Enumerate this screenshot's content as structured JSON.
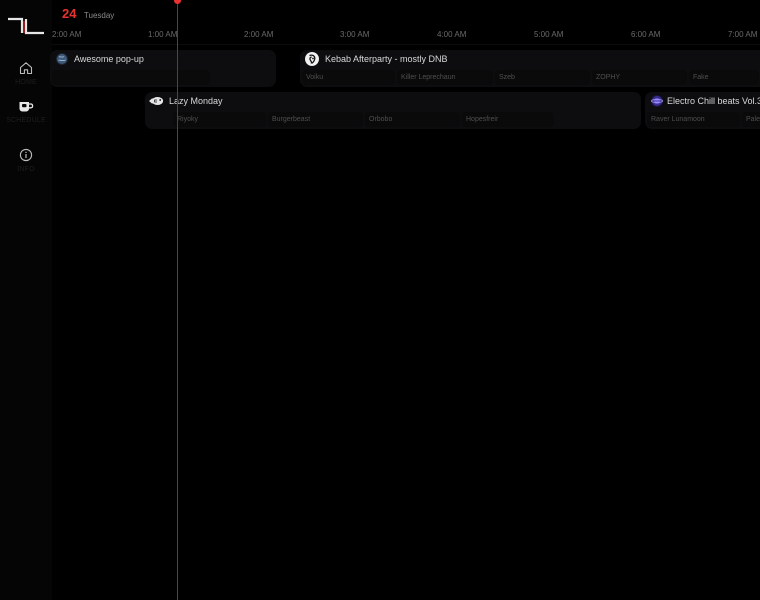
{
  "header": {
    "day_number": "24",
    "weekday": "Tuesday"
  },
  "sidebar": {
    "items": [
      {
        "icon": "home-icon",
        "label": "HOME"
      },
      {
        "icon": "mug-icon",
        "label": "SCHEDULE"
      },
      {
        "icon": "info-icon",
        "label": "INFO"
      }
    ]
  },
  "timeline": {
    "labels": [
      "2:00 AM",
      "1:00 AM",
      "2:00 AM",
      "3:00 AM",
      "4:00 AM",
      "5:00 AM",
      "6:00 AM",
      "7:00 AM"
    ]
  },
  "shows": [
    {
      "title": "Awesome pop-up",
      "avatar": "globe-icon",
      "djs": []
    },
    {
      "title": "Kebab Afterparty - mostly DNB",
      "avatar": "skull-icon",
      "djs": [
        "Voiku",
        "Killer Leprechaun",
        "Szeb",
        "ZOPHY",
        "Fake"
      ]
    },
    {
      "title": "Lazy Monday",
      "avatar": "fish-icon",
      "djs": [
        "Riyoky",
        "Burgerbeast",
        "Orbobo",
        "Hopesfreir"
      ]
    },
    {
      "title": "Electro Chill beats Vol.3",
      "avatar": "planet-icon",
      "djs": [
        "Raver Lunamoon",
        "Pale"
      ]
    }
  ],
  "colors": {
    "accent": "#e8322f",
    "now_line": "#b3191c",
    "background": "#000000",
    "card": "#0d0d0f"
  }
}
